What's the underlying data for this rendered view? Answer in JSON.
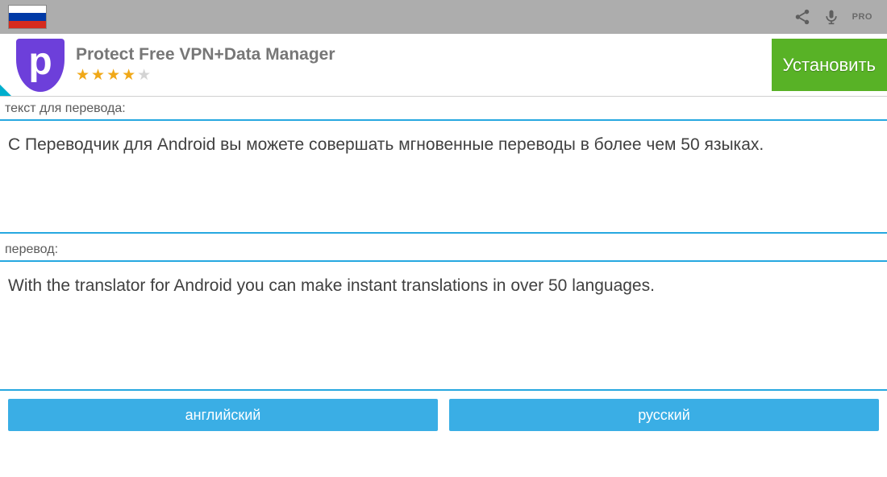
{
  "topbar": {
    "pro_label": "PRO"
  },
  "ad": {
    "icon_letter": "p",
    "title": "Protect Free VPN+Data Manager",
    "rating": 4,
    "install_label": "Установить"
  },
  "source": {
    "label": "текст для перевода:",
    "text": "С Переводчик для Android вы можете совершать мгновенные переводы в более чем 50 языках."
  },
  "target": {
    "label": "перевод:",
    "text": "With the translator for Android you can make instant translations in over 50 languages."
  },
  "languages": {
    "source_btn": "английский",
    "target_btn": "русский"
  }
}
